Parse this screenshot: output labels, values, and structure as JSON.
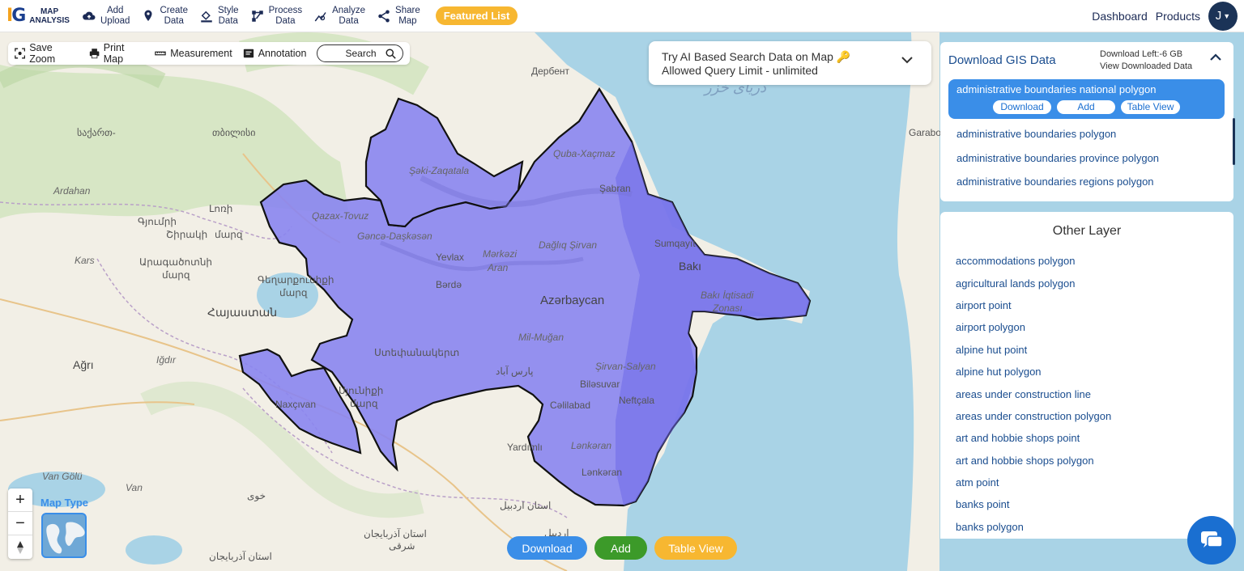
{
  "nav": {
    "logo_top": "MAP",
    "logo_bottom": "ANALYSIS",
    "items": [
      {
        "line1": "Add",
        "line2": "Upload",
        "icon": "cloud-upload-icon"
      },
      {
        "line1": "Create",
        "line2": "Data",
        "icon": "map-pin-icon"
      },
      {
        "line1": "Style",
        "line2": "Data",
        "icon": "paint-bucket-icon"
      },
      {
        "line1": "Process",
        "line2": "Data",
        "icon": "process-icon"
      },
      {
        "line1": "Analyze",
        "line2": "Data",
        "icon": "analyze-icon"
      },
      {
        "line1": "Share",
        "line2": "Map",
        "icon": "share-icon"
      }
    ],
    "featured": "Featured List",
    "dashboard": "Dashboard",
    "products": "Products",
    "avatar_letter": "J"
  },
  "toolbar": {
    "save_zoom": "Save Zoom",
    "print_map": "Print Map",
    "measurement": "Measurement",
    "annotation": "Annotation",
    "search": "Search"
  },
  "ai_search": {
    "line1": "Try AI Based Search Data on Map",
    "line2": "Allowed Query Limit - unlimited"
  },
  "download_panel": {
    "title": "Download GIS Data",
    "download_left": "Download Left:-6 GB",
    "view_downloaded": "View Downloaded Data",
    "selected": {
      "name": "administrative boundaries national polygon",
      "download": "Download",
      "add": "Add",
      "table_view": "Table View"
    },
    "items": [
      "administrative boundaries polygon",
      "administrative boundaries province polygon",
      "administrative boundaries regions polygon"
    ]
  },
  "other_layer": {
    "title": "Other Layer",
    "items": [
      "accommodations polygon",
      "agricultural lands polygon",
      "airport point",
      "airport polygon",
      "alpine hut point",
      "alpine hut polygon",
      "areas under construction line",
      "areas under construction polygon",
      "art and hobbie shops point",
      "art and hobbie shops polygon",
      "atm point",
      "banks point",
      "banks polygon"
    ]
  },
  "map": {
    "map_type": "Map Type",
    "zoom_in": "+",
    "zoom_out": "−",
    "labels": {
      "derbent": "Дербент",
      "sea": "دریای خزر",
      "garabo": "Garabo",
      "tbilisi": "თბილისი",
      "georgia_region": "საქართ-",
      "ardahan": "Ardahan",
      "gyumri": "Գյումրի",
      "lori": "Լոռի",
      "lori2": "մարզ",
      "shirak": "Շիրակի",
      "kars": "Kars",
      "aragatsotn": "Արագածոտնի",
      "aragatsotn2": "մարզ",
      "gegharkunik": "Գեղարքունիքի",
      "gegharkunik2": "մարզ",
      "armenia": "Հայաստան",
      "igdir": "Iğdır",
      "agri": "Ağrı",
      "nakhchivan": "Naxçıvan",
      "van_golu": "Van Gölü",
      "van": "Van",
      "khoy": "خوی",
      "syunik": "Սյունիքի",
      "syunik2": "մարզ",
      "parsabad": "پارس آباد",
      "yardimli": "Yardımlı",
      "ardabil": "استان اردبیل",
      "ardabil_city": "اردبیل",
      "azerbaijan_east": "استان آذربایجان",
      "azerbaijan_east2": "شرقی",
      "azerbaijan_west": "استان آذربایجان",
      "quba": "Quba-Xaçmaz",
      "shaki": "Şəki-Zaqatala",
      "shabran": "Şabran",
      "qazax": "Qazax-Tovuz",
      "ganja": "Gəncə-Daşkəsən",
      "daglig": "Dağlıq Şirvan",
      "sumqayit": "Sumqayıt",
      "yevlax": "Yevlax",
      "markazi": "Mərkəzi",
      "aran": "Aran",
      "baku": "Bakı",
      "baku_econ": "Bakı İqtisadi",
      "baku_econ2": "Zonası",
      "barda": "Bərdə",
      "azerbaijan": "Azərbaycan",
      "mil_mugan": "Mil-Muğan",
      "stepanakert": "Ստեփանակերտ",
      "shirvan_salyan": "Şirvan-Salyan",
      "bilasuvar": "Biləsuvar",
      "neftchala": "Neftçala",
      "jalilabad": "Cəlilabad",
      "lankaran_region": "Lənkəran",
      "lankaran": "Lənkəran"
    }
  },
  "bottom": {
    "download": "Download",
    "add": "Add",
    "table_view": "Table View"
  },
  "colors": {
    "navy": "#1b2a55",
    "accent_blue": "#3a8ee8",
    "featured": "#f7b731",
    "add_green": "#3c9a29",
    "table_orange": "#f7b731",
    "download_blue": "#3a8ee8",
    "polygon_fill": "#8a85f0",
    "sea": "#a9d3e6"
  }
}
